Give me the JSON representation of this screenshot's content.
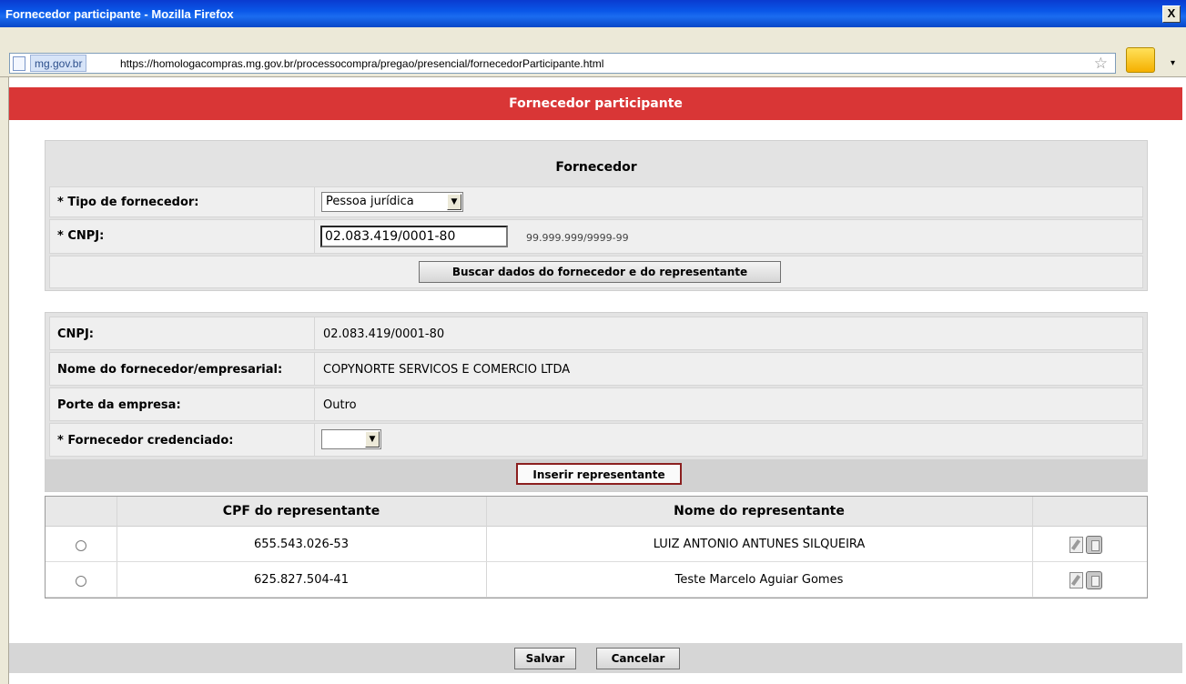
{
  "window": {
    "title": "Fornecedor participante - Mozilla Firefox",
    "close_label": "X"
  },
  "addressbar": {
    "site_label": "mg.gov.br",
    "url": "https://homologacompras.mg.gov.br/processocompra/pregao/presencial/fornecedorParticipante.html",
    "star": "☆",
    "dropdown": "▾"
  },
  "page": {
    "header": "Fornecedor participante"
  },
  "fornecedor": {
    "section_title": "Fornecedor",
    "tipo_label": "* Tipo de fornecedor:",
    "tipo_value": "Pessoa jurídica",
    "cnpj_label": "* CNPJ:",
    "cnpj_value": "02.083.419/0001-80",
    "cnpj_hint": "99.999.999/9999-99",
    "buscar_button": "Buscar dados do fornecedor e do representante"
  },
  "dados": {
    "cnpj_label": "CNPJ:",
    "cnpj_value": "02.083.419/0001-80",
    "nome_label": "Nome do fornecedor/empresarial:",
    "nome_value": "COPYNORTE SERVICOS E COMERCIO LTDA",
    "porte_label": "Porte da empresa:",
    "porte_value": "Outro",
    "credenciado_label": "* Fornecedor credenciado:",
    "credenciado_value": "",
    "inserir_button": "Inserir representante"
  },
  "representantes": {
    "columns": [
      "CPF do representante",
      "Nome do representante"
    ],
    "rows": [
      {
        "cpf": "655.543.026-53",
        "nome": "LUIZ ANTONIO ANTUNES SILQUEIRA"
      },
      {
        "cpf": "625.827.504-41",
        "nome": "Teste Marcelo Aguiar Gomes"
      }
    ]
  },
  "footer": {
    "salvar": "Salvar",
    "cancelar": "Cancelar"
  },
  "icons": {
    "select_arrow": "▼"
  }
}
